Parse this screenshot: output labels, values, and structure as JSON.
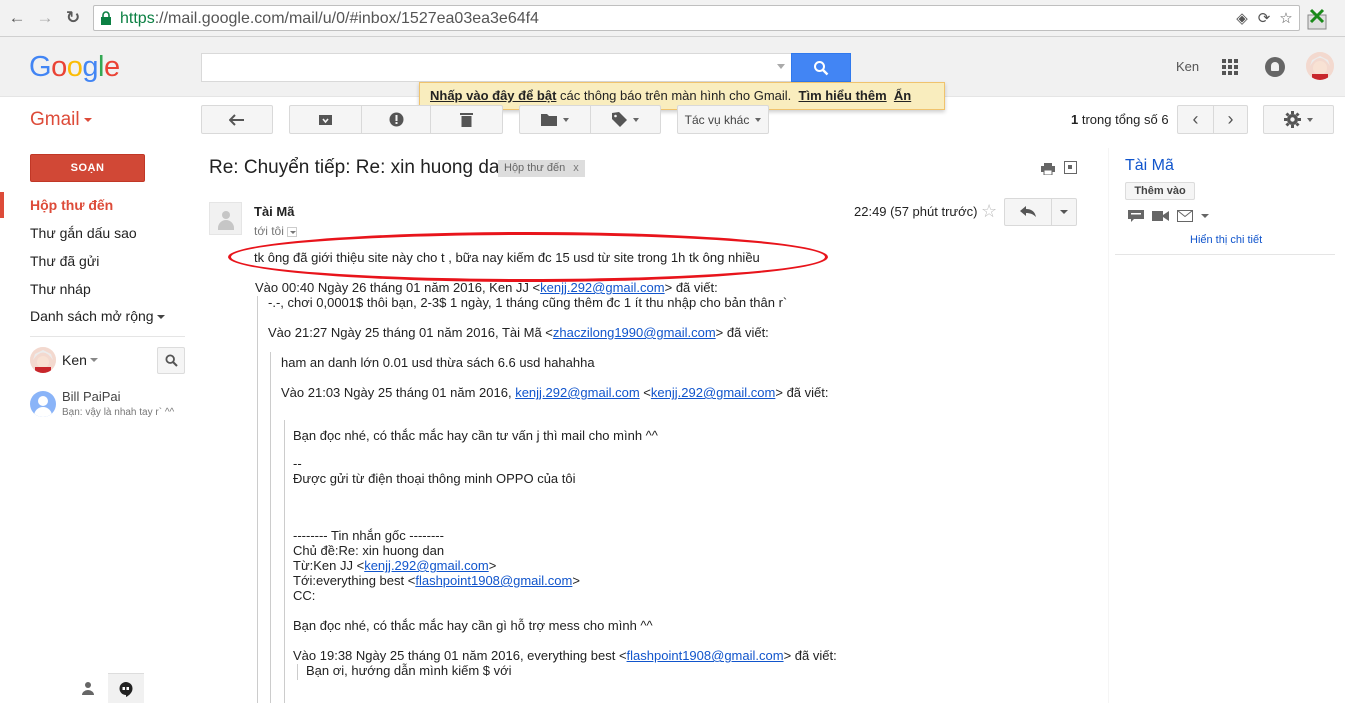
{
  "browser": {
    "url_scheme": "https",
    "url_rest": "://mail.google.com/mail/u/0/#inbox/1527ea03ea3e64f4"
  },
  "header": {
    "logo_letters": [
      "G",
      "o",
      "o",
      "g",
      "l",
      "e"
    ],
    "user_name": "Ken"
  },
  "banner": {
    "link1": "Nhấp vào đây để bật",
    "text": " các thông báo trên màn hình cho Gmail.",
    "link2": "Tìm hiểu thêm",
    "link3": "Ẩn"
  },
  "toolbar": {
    "gmail_label": "Gmail",
    "more_actions": "Tác vụ khác",
    "pager_current": "1",
    "pager_text": " trong tổng số 6"
  },
  "sidebar": {
    "compose": "SOẠN",
    "items": [
      {
        "label": "Hộp thư đến",
        "active": true
      },
      {
        "label": "Thư gắn dấu sao"
      },
      {
        "label": "Thư đã gửi"
      },
      {
        "label": "Thư nháp"
      },
      {
        "label": "Danh sách mở rộng"
      }
    ],
    "chat_me": "Ken",
    "contact": {
      "name": "Bill PaiPai",
      "status": "Bạn: vậy là nhah tay r` ^^"
    }
  },
  "message": {
    "subject": "Re: Chuyển tiếp: Re: xin huong dan",
    "label": "Hộp thư đến",
    "label_close": "x",
    "sender": "Tài Mã",
    "to": "tới tôi",
    "time": "22:49 (57 phút trước)",
    "lines": {
      "l1": "tk ông đã giới thiệu site này cho t , bữa nay kiếm đc 15 usd từ site trong 1h tk ông nhiều",
      "l2_pre": "Vào 00:40 Ngày 26 tháng 01 năm 2016, Ken JJ <",
      "l2_link": "kenjj.292@gmail.com",
      "l2_post": "> đã viết:",
      "l3": "-.-, chơi 0,0001$ thôi bạn, 2-3$ 1 ngày, 1 tháng cũng thêm đc 1 ít thu nhập cho bản thân r`",
      "l4_pre": "Vào 21:27 Ngày 25 tháng 01 năm 2016, Tài Mã <",
      "l4_link": "zhaczilong1990@gmail.com",
      "l4_post": "> đã viết:",
      "l5": "ham an danh lớn 0.01 usd thừa sách 6.6 usd hahahha",
      "l6_pre": "Vào 21:03 Ngày 25 tháng 01 năm 2016, ",
      "l6_link1": "kenjj.292@gmail.com",
      "l6_mid": " <",
      "l6_link2": "kenjj.292@gmail.com",
      "l6_post": "> đã viết:",
      "l7": "Bạn đọc nhé, có thắc mắc hay cần tư vấn j thì mail cho mình ^^",
      "l8": "--",
      "l9": "Được gửi từ điện thoại thông minh OPPO của tôi",
      "l10": "-------- Tin nhắn gốc --------",
      "l11": "Chủ đề:Re: xin huong dan",
      "l12_pre": "Từ:Ken JJ <",
      "l12_link": "kenjj.292@gmail.com",
      "l12_post": ">",
      "l13_pre": "Tới:everything best <",
      "l13_link": "flashpoint1908@gmail.com",
      "l13_post": ">",
      "l14": "CC:",
      "l15": "Bạn đọc nhé, có thắc mắc hay cần gì hỗ trợ mess cho mình ^^",
      "l16_pre": "Vào 19:38 Ngày 25 tháng 01 năm 2016, everything best <",
      "l16_link": "flashpoint1908@gmail.com",
      "l16_post": "> đã viết:",
      "l17": "Bạn ơi, hướng dẫn mình kiếm $ với"
    }
  },
  "right_panel": {
    "name": "Tài Mã",
    "add_button": "Thêm vào",
    "details_link": "Hiển thị chi tiết"
  },
  "colors": {
    "gmail_red": "#dd4b39",
    "search_blue": "#4285f4",
    "link_blue": "#1155cc",
    "annotation_red": "#e8141b"
  }
}
